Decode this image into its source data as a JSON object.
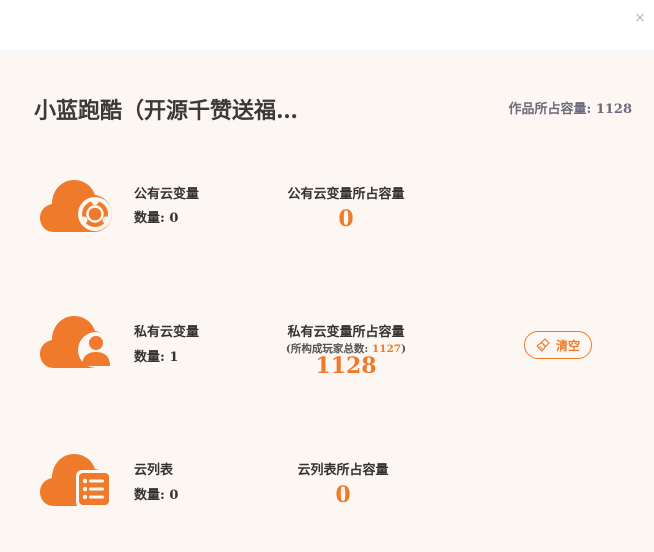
{
  "window": {
    "close_glyph": "×"
  },
  "header": {
    "title": "小蓝跑酷（开源千赞送福…",
    "total_label": "作品所占容量: ",
    "total_value": "1128"
  },
  "rows": [
    {
      "name": "公有云变量",
      "count_label": "数量: ",
      "count": "0",
      "capacity_label": "公有云变量所占容量",
      "capacity_value": "0",
      "icon": "cloud-share-icon"
    },
    {
      "name": "私有云变量",
      "count_label": "数量: ",
      "count": "1",
      "capacity_label": "私有云变量所占容量",
      "players_prefix": "(所构成玩家总数: ",
      "players_value": "1127",
      "players_suffix": ")",
      "capacity_value": "1128",
      "icon": "cloud-user-icon"
    },
    {
      "name": "云列表",
      "count_label": "数量: ",
      "count": "0",
      "capacity_label": "云列表所占容量",
      "capacity_value": "0",
      "icon": "cloud-list-icon"
    }
  ],
  "actions": {
    "clear_label": "清空",
    "clear_icon": "broom-icon"
  },
  "colors": {
    "accent": "#f07a2c",
    "panel_bg": "#fdf7f3"
  }
}
